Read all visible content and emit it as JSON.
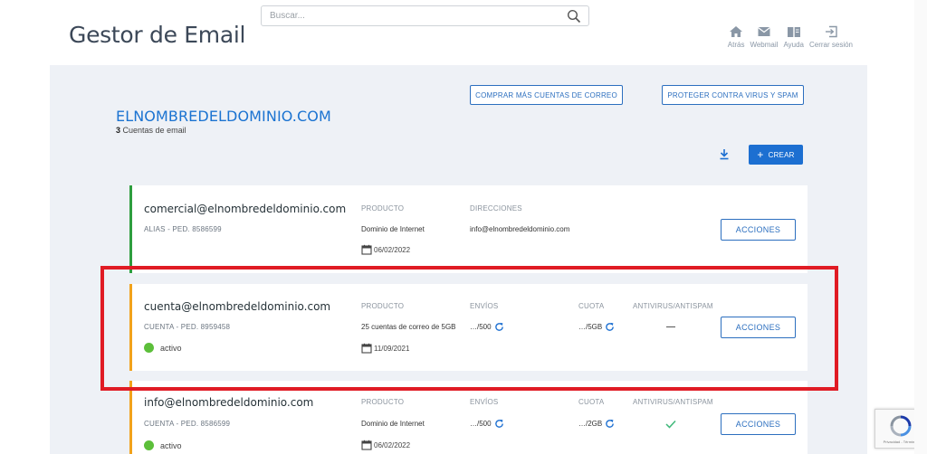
{
  "header": {
    "title": "Gestor de Email",
    "search_placeholder": "Buscar...",
    "nav": [
      {
        "label": "Atrás",
        "icon": "home-icon"
      },
      {
        "label": "Webmail",
        "icon": "mail-icon"
      },
      {
        "label": "Ayuda",
        "icon": "book-icon"
      },
      {
        "label": "Cerrar sesión",
        "icon": "logout-icon"
      }
    ]
  },
  "domain": {
    "name": "ELNOMBREDELDOMINIO.COM",
    "count": "3",
    "count_label": "Cuentas de email"
  },
  "buttons": {
    "buy": "COMPRAR MÁS CUENTAS DE CORREO",
    "protect": "PROTEGER CONTRA VIRUS Y SPAM",
    "create": "CREAR",
    "actions": "ACCIONES"
  },
  "labels": {
    "producto": "PRODUCTO",
    "direcciones": "DIRECCIONES",
    "envios": "ENVÍOS",
    "cuota": "CUOTA",
    "antivirus": "ANTIVIRUS/ANTISPAM"
  },
  "accounts": [
    {
      "email": "comercial@elnombredeldominio.com",
      "sub": "ALIAS - PED. 8586599",
      "producto": "Dominio de Internet",
      "direcciones": "info@elnombredeldominio.com",
      "date": "06/02/2022",
      "stripe_color": "#2e9e3e"
    },
    {
      "email": "cuenta@elnombredeldominio.com",
      "sub": "CUENTA - PED. 8959458",
      "status": "activo",
      "producto": "25 cuentas de correo de 5GB",
      "envios": "…/500",
      "cuota": "…/5GB",
      "date": "11/09/2021",
      "stripe_color": "#f2a21b"
    },
    {
      "email": "info@elnombredeldominio.com",
      "sub": "CUENTA - PED. 8586599",
      "status": "activo",
      "producto": "Dominio de Internet",
      "envios": "…/500",
      "cuota": "…/2GB",
      "date": "06/02/2022",
      "stripe_color": "#f2a21b"
    }
  ],
  "recaptcha": {
    "text": "Privacidad - Términos"
  },
  "colors": {
    "accent": "#1c6fd1",
    "highlight": "#e01b24",
    "status_active": "#5cbf3a"
  }
}
